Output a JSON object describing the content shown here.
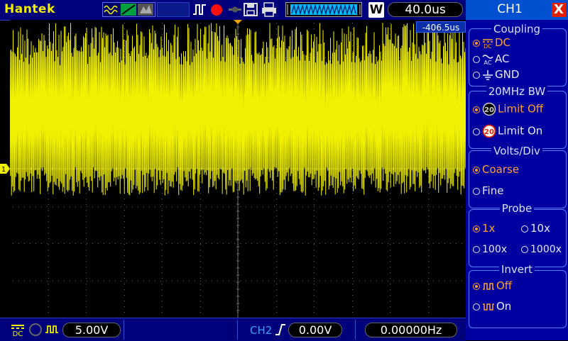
{
  "topbar": {
    "brand": "Hantek",
    "timebase": "40.0us",
    "w_label": "W"
  },
  "screen": {
    "trigger_offset": "-406.5us",
    "channel_marker": "1",
    "trace_color": "#f0f000"
  },
  "bottombar": {
    "ch1_volts": "5.00V",
    "trigger_source": "CH2",
    "trigger_level": "0.00V",
    "frequency": "0.00000Hz"
  },
  "panel": {
    "title": "CH1",
    "close_label": "X",
    "coupling": {
      "title": "Coupling",
      "options": [
        "DC",
        "AC",
        "GND"
      ],
      "selected": 0
    },
    "bandwidth": {
      "title": "20MHz BW",
      "options": [
        "Limit Off",
        "Limit On"
      ],
      "badge": "20",
      "selected": 0
    },
    "volts_div": {
      "title": "Volts/Div",
      "options": [
        "Coarse",
        "Fine"
      ],
      "selected": 0
    },
    "probe": {
      "title": "Probe",
      "options": [
        "1x",
        "10x",
        "100x",
        "1000x"
      ],
      "selected": 0
    },
    "invert": {
      "title": "Invert",
      "options": [
        "Off",
        "On"
      ],
      "selected": 0
    }
  },
  "colors": {
    "accent": "#ffa030",
    "panel_bg": "#0000a0",
    "bar_bg": "#00007a"
  }
}
